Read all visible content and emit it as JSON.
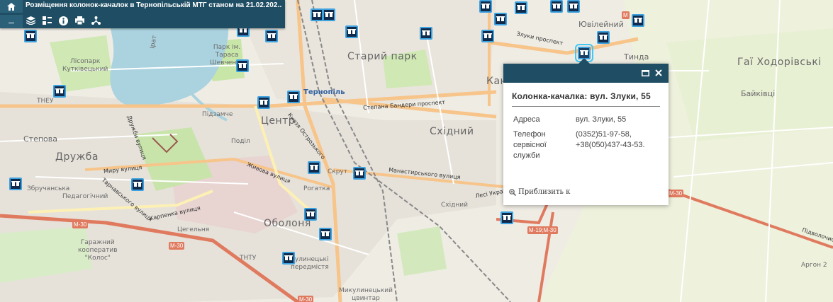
{
  "app": {
    "title": "Розміщення колонок-качалок в Тернопільській МТГ станом на 21.02.202...",
    "zoom_out_label": "–"
  },
  "toolbar": {
    "icons": [
      "home-icon",
      "layers-icon",
      "legend-icon",
      "info-icon",
      "print-icon",
      "share-icon"
    ]
  },
  "map": {
    "places": {
      "yuvileinyi": "Ювілейний",
      "tynda": "Тинда",
      "hai_khodorivski": "Гаї Ходорівські",
      "baikivtsi": "Байківці",
      "staryi_park": "Старий парк",
      "skhidnyi": "Східний",
      "skhidnyi_small": "Східний",
      "kan": "Кан",
      "tsentr": "Центр",
      "druzhba": "Дружба",
      "stepova": "Степова",
      "obolonia": "Оболоня",
      "tseglyana": "Цегельня",
      "ternopil": "Тернопіль",
      "lisopark": "Лісопарк\nКутківецький",
      "park_shevchenko": "Парк ім.\nТараса\nШевченка",
      "tneu": "ТНЕУ",
      "tntu": "ТНТУ",
      "pidzamche": "Підзамче",
      "podil": "Поділ",
      "skrut": "Скрут",
      "rogatka": "Рогатка",
      "zbruchanska": "Збручанська",
      "pedagogichnyi": "Педагогічний",
      "garage": "Гаражний\nкооператив\n\"Колос\"",
      "kutyl": "кулинецькі\nпередмістя",
      "mykulynetskyi": "Микулинецький\nцвинтар",
      "argon": "Аргон 2",
      "prat": "Ірат"
    },
    "roads": {
      "stepan_bandera": "Степана Бандери проспект",
      "zluky": "Злуки проспект",
      "monastyrskoho": "Манастирського вулиця",
      "lesi_ukrainky": "Лесі Українки",
      "myru": "Миру вулиця",
      "karpenka": "Карпенка вулиця",
      "zhyvova": "Живова вулиця",
      "knyazya_ostrozkoho": "Князя Острозького",
      "druzhby": "Дружби вулиця",
      "tarnavskoho": "Тарнавського вулиця",
      "pidvolochyske": "Підволочиське",
      "m30_a": "М-30",
      "m30_b": "М-30",
      "m30_c": "М-30",
      "m30_d": "М-30",
      "m30_e": "М-30",
      "m19": "М-19;М-30",
      "m_top": "М"
    },
    "markers_count": 29
  },
  "popup": {
    "title": "Колонка-качалка: вул. Злуки, 55",
    "attributes": [
      {
        "key": "Адреса",
        "value": "вул. Злуки, 55"
      },
      {
        "key": "Телефон сервісної служби",
        "value": "(0352)51-97-58, +38(050)437-43-53."
      }
    ],
    "zoom_link": "Приблизить к",
    "maximize_icon": "maximize-icon",
    "close_icon": "close-icon"
  },
  "colors": {
    "header": "#1f4e64",
    "marker_fill": "#0f2a4a",
    "marker_border": "#3da2e0",
    "lake": "#aad3df",
    "major_road": "#f7c48a",
    "motorway": "#e07a5f"
  }
}
